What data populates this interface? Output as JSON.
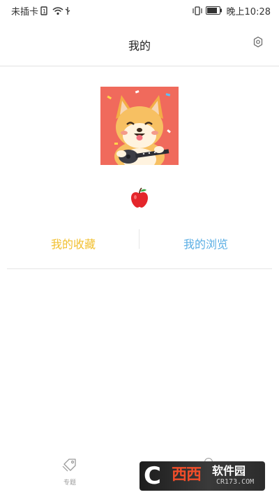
{
  "status_bar": {
    "carrier": "未插卡",
    "time": "晚上10:28"
  },
  "header": {
    "title": "我的"
  },
  "tabs": {
    "favorites": "我的收藏",
    "history": "我的浏览"
  },
  "bottom_nav": {
    "topics_label": "专题"
  },
  "watermark": {
    "brand": "西西软件园",
    "domain": "CR173.COM"
  },
  "colors": {
    "favorites": "#f2c030",
    "history": "#5aaee4",
    "avatar_bg": "#f06a5c"
  }
}
